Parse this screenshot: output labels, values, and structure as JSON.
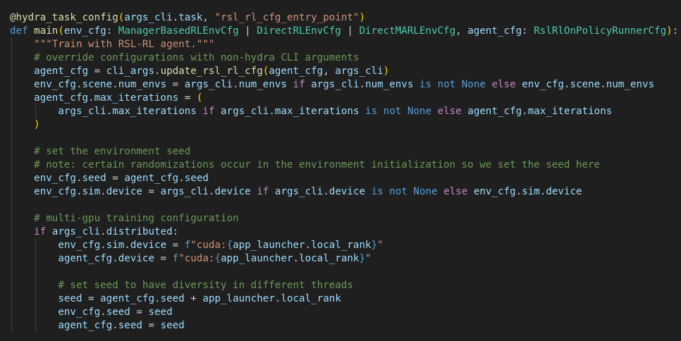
{
  "editor": {
    "theme_bg": "#1f1f1f",
    "lines": [
      {
        "indent": 0,
        "tokens": [
          {
            "t": "@",
            "c": "dec"
          },
          {
            "t": "hydra_task_config",
            "c": "fn"
          },
          {
            "t": "(",
            "c": "brk"
          },
          {
            "t": "args_cli",
            "c": "var"
          },
          {
            "t": ".",
            "c": "p"
          },
          {
            "t": "task",
            "c": "var"
          },
          {
            "t": ", ",
            "c": "p"
          },
          {
            "t": "\"rsl_rl_cfg_entry_point\"",
            "c": "str"
          },
          {
            "t": ")",
            "c": "brk"
          }
        ]
      },
      {
        "indent": 0,
        "tokens": [
          {
            "t": "def",
            "c": "kw"
          },
          {
            "t": " ",
            "c": "p"
          },
          {
            "t": "main",
            "c": "fn"
          },
          {
            "t": "(",
            "c": "brk"
          },
          {
            "t": "env_cfg",
            "c": "var"
          },
          {
            "t": ": ",
            "c": "p"
          },
          {
            "t": "ManagerBasedRLEnvCfg",
            "c": "type"
          },
          {
            "t": " | ",
            "c": "p"
          },
          {
            "t": "DirectRLEnvCfg",
            "c": "type"
          },
          {
            "t": " | ",
            "c": "p"
          },
          {
            "t": "DirectMARLEnvCfg",
            "c": "type"
          },
          {
            "t": ", ",
            "c": "p"
          },
          {
            "t": "agent_cfg",
            "c": "var"
          },
          {
            "t": ": ",
            "c": "p"
          },
          {
            "t": "RslRlOnPolicyRunnerCfg",
            "c": "type"
          },
          {
            "t": ")",
            "c": "brk"
          },
          {
            "t": ":",
            "c": "p"
          }
        ]
      },
      {
        "indent": 1,
        "tokens": [
          {
            "t": "\"\"\"Train with RSL-RL agent.\"\"\"",
            "c": "str"
          }
        ]
      },
      {
        "indent": 1,
        "tokens": [
          {
            "t": "# override configurations with non-hydra CLI arguments",
            "c": "com"
          }
        ]
      },
      {
        "indent": 1,
        "tokens": [
          {
            "t": "agent_cfg",
            "c": "var"
          },
          {
            "t": " = ",
            "c": "p"
          },
          {
            "t": "cli_args",
            "c": "var"
          },
          {
            "t": ".",
            "c": "p"
          },
          {
            "t": "update_rsl_rl_cfg",
            "c": "fn"
          },
          {
            "t": "(",
            "c": "brk"
          },
          {
            "t": "agent_cfg",
            "c": "var"
          },
          {
            "t": ", ",
            "c": "p"
          },
          {
            "t": "args_cli",
            "c": "var"
          },
          {
            "t": ")",
            "c": "brk"
          }
        ]
      },
      {
        "indent": 1,
        "tokens": [
          {
            "t": "env_cfg",
            "c": "var"
          },
          {
            "t": ".",
            "c": "p"
          },
          {
            "t": "scene",
            "c": "var"
          },
          {
            "t": ".",
            "c": "p"
          },
          {
            "t": "num_envs",
            "c": "var"
          },
          {
            "t": " = ",
            "c": "p"
          },
          {
            "t": "args_cli",
            "c": "var"
          },
          {
            "t": ".",
            "c": "p"
          },
          {
            "t": "num_envs",
            "c": "var"
          },
          {
            "t": " ",
            "c": "p"
          },
          {
            "t": "if",
            "c": "ctl"
          },
          {
            "t": " ",
            "c": "p"
          },
          {
            "t": "args_cli",
            "c": "var"
          },
          {
            "t": ".",
            "c": "p"
          },
          {
            "t": "num_envs",
            "c": "var"
          },
          {
            "t": " ",
            "c": "p"
          },
          {
            "t": "is not",
            "c": "kw"
          },
          {
            "t": " ",
            "c": "p"
          },
          {
            "t": "None",
            "c": "kw"
          },
          {
            "t": " ",
            "c": "p"
          },
          {
            "t": "else",
            "c": "ctl"
          },
          {
            "t": " ",
            "c": "p"
          },
          {
            "t": "env_cfg",
            "c": "var"
          },
          {
            "t": ".",
            "c": "p"
          },
          {
            "t": "scene",
            "c": "var"
          },
          {
            "t": ".",
            "c": "p"
          },
          {
            "t": "num_envs",
            "c": "var"
          }
        ]
      },
      {
        "indent": 1,
        "tokens": [
          {
            "t": "agent_cfg",
            "c": "var"
          },
          {
            "t": ".",
            "c": "p"
          },
          {
            "t": "max_iterations",
            "c": "var"
          },
          {
            "t": " = ",
            "c": "p"
          },
          {
            "t": "(",
            "c": "brk"
          }
        ]
      },
      {
        "indent": 2,
        "tokens": [
          {
            "t": "args_cli",
            "c": "var"
          },
          {
            "t": ".",
            "c": "p"
          },
          {
            "t": "max_iterations",
            "c": "var"
          },
          {
            "t": " ",
            "c": "p"
          },
          {
            "t": "if",
            "c": "ctl"
          },
          {
            "t": " ",
            "c": "p"
          },
          {
            "t": "args_cli",
            "c": "var"
          },
          {
            "t": ".",
            "c": "p"
          },
          {
            "t": "max_iterations",
            "c": "var"
          },
          {
            "t": " ",
            "c": "p"
          },
          {
            "t": "is not",
            "c": "kw"
          },
          {
            "t": " ",
            "c": "p"
          },
          {
            "t": "None",
            "c": "kw"
          },
          {
            "t": " ",
            "c": "p"
          },
          {
            "t": "else",
            "c": "ctl"
          },
          {
            "t": " ",
            "c": "p"
          },
          {
            "t": "agent_cfg",
            "c": "var"
          },
          {
            "t": ".",
            "c": "p"
          },
          {
            "t": "max_iterations",
            "c": "var"
          }
        ]
      },
      {
        "indent": 1,
        "tokens": [
          {
            "t": ")",
            "c": "brk"
          }
        ]
      },
      {
        "indent": 1,
        "blank": true,
        "tokens": []
      },
      {
        "indent": 1,
        "tokens": [
          {
            "t": "# set the environment seed",
            "c": "com"
          }
        ]
      },
      {
        "indent": 1,
        "tokens": [
          {
            "t": "# note: certain randomizations occur in the environment initialization so we set the seed here",
            "c": "com"
          }
        ]
      },
      {
        "indent": 1,
        "tokens": [
          {
            "t": "env_cfg",
            "c": "var"
          },
          {
            "t": ".",
            "c": "p"
          },
          {
            "t": "seed",
            "c": "var"
          },
          {
            "t": " = ",
            "c": "p"
          },
          {
            "t": "agent_cfg",
            "c": "var"
          },
          {
            "t": ".",
            "c": "p"
          },
          {
            "t": "seed",
            "c": "var"
          }
        ]
      },
      {
        "indent": 1,
        "tokens": [
          {
            "t": "env_cfg",
            "c": "var"
          },
          {
            "t": ".",
            "c": "p"
          },
          {
            "t": "sim",
            "c": "var"
          },
          {
            "t": ".",
            "c": "p"
          },
          {
            "t": "device",
            "c": "var"
          },
          {
            "t": " = ",
            "c": "p"
          },
          {
            "t": "args_cli",
            "c": "var"
          },
          {
            "t": ".",
            "c": "p"
          },
          {
            "t": "device",
            "c": "var"
          },
          {
            "t": " ",
            "c": "p"
          },
          {
            "t": "if",
            "c": "ctl"
          },
          {
            "t": " ",
            "c": "p"
          },
          {
            "t": "args_cli",
            "c": "var"
          },
          {
            "t": ".",
            "c": "p"
          },
          {
            "t": "device",
            "c": "var"
          },
          {
            "t": " ",
            "c": "p"
          },
          {
            "t": "is not",
            "c": "kw"
          },
          {
            "t": " ",
            "c": "p"
          },
          {
            "t": "None",
            "c": "kw"
          },
          {
            "t": " ",
            "c": "p"
          },
          {
            "t": "else",
            "c": "ctl"
          },
          {
            "t": " ",
            "c": "p"
          },
          {
            "t": "env_cfg",
            "c": "var"
          },
          {
            "t": ".",
            "c": "p"
          },
          {
            "t": "sim",
            "c": "var"
          },
          {
            "t": ".",
            "c": "p"
          },
          {
            "t": "device",
            "c": "var"
          }
        ]
      },
      {
        "indent": 1,
        "blank": true,
        "tokens": []
      },
      {
        "indent": 1,
        "tokens": [
          {
            "t": "# multi-gpu training configuration",
            "c": "com"
          }
        ]
      },
      {
        "indent": 1,
        "tokens": [
          {
            "t": "if",
            "c": "ctl"
          },
          {
            "t": " ",
            "c": "p"
          },
          {
            "t": "args_cli",
            "c": "var"
          },
          {
            "t": ".",
            "c": "p"
          },
          {
            "t": "distributed",
            "c": "var"
          },
          {
            "t": ":",
            "c": "p"
          }
        ]
      },
      {
        "indent": 2,
        "tokens": [
          {
            "t": "env_cfg",
            "c": "var"
          },
          {
            "t": ".",
            "c": "p"
          },
          {
            "t": "sim",
            "c": "var"
          },
          {
            "t": ".",
            "c": "p"
          },
          {
            "t": "device",
            "c": "var"
          },
          {
            "t": " = ",
            "c": "p"
          },
          {
            "t": "f",
            "c": "kw"
          },
          {
            "t": "\"cuda:",
            "c": "str"
          },
          {
            "t": "{",
            "c": "kw"
          },
          {
            "t": "app_launcher",
            "c": "var"
          },
          {
            "t": ".",
            "c": "p"
          },
          {
            "t": "local_rank",
            "c": "var"
          },
          {
            "t": "}",
            "c": "kw"
          },
          {
            "t": "\"",
            "c": "str"
          }
        ]
      },
      {
        "indent": 2,
        "tokens": [
          {
            "t": "agent_cfg",
            "c": "var"
          },
          {
            "t": ".",
            "c": "p"
          },
          {
            "t": "device",
            "c": "var"
          },
          {
            "t": " = ",
            "c": "p"
          },
          {
            "t": "f",
            "c": "kw"
          },
          {
            "t": "\"cuda:",
            "c": "str"
          },
          {
            "t": "{",
            "c": "kw"
          },
          {
            "t": "app_launcher",
            "c": "var"
          },
          {
            "t": ".",
            "c": "p"
          },
          {
            "t": "local_rank",
            "c": "var"
          },
          {
            "t": "}",
            "c": "kw"
          },
          {
            "t": "\"",
            "c": "str"
          }
        ]
      },
      {
        "indent": 2,
        "blank": true,
        "tokens": []
      },
      {
        "indent": 2,
        "tokens": [
          {
            "t": "# set seed to have diversity in different threads",
            "c": "com"
          }
        ]
      },
      {
        "indent": 2,
        "tokens": [
          {
            "t": "seed",
            "c": "var"
          },
          {
            "t": " = ",
            "c": "p"
          },
          {
            "t": "agent_cfg",
            "c": "var"
          },
          {
            "t": ".",
            "c": "p"
          },
          {
            "t": "seed",
            "c": "var"
          },
          {
            "t": " + ",
            "c": "p"
          },
          {
            "t": "app_launcher",
            "c": "var"
          },
          {
            "t": ".",
            "c": "p"
          },
          {
            "t": "local_rank",
            "c": "var"
          }
        ]
      },
      {
        "indent": 2,
        "tokens": [
          {
            "t": "env_cfg",
            "c": "var"
          },
          {
            "t": ".",
            "c": "p"
          },
          {
            "t": "seed",
            "c": "var"
          },
          {
            "t": " = ",
            "c": "p"
          },
          {
            "t": "seed",
            "c": "var"
          }
        ]
      },
      {
        "indent": 2,
        "tokens": [
          {
            "t": "agent_cfg",
            "c": "var"
          },
          {
            "t": ".",
            "c": "p"
          },
          {
            "t": "seed",
            "c": "var"
          },
          {
            "t": " = ",
            "c": "p"
          },
          {
            "t": "seed",
            "c": "var"
          }
        ]
      }
    ]
  }
}
